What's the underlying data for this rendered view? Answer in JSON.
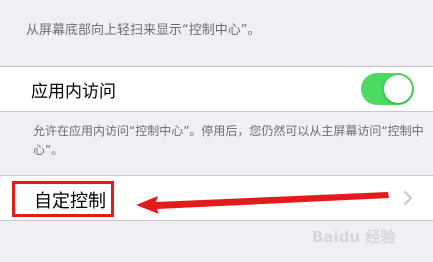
{
  "top_group": {
    "footer": "从屏幕底部向上轻扫来显示“控制中心”。"
  },
  "in_app_access": {
    "label": "应用内访问",
    "toggle_on": true,
    "toggle_color": "#4cd964",
    "footer": "允许在应用内访问“控制中心”。停用后，您仍然可以从主屏幕访问“控制中心”。"
  },
  "customize": {
    "label": "自定控制",
    "chevron_icon": "chevron-right-icon"
  },
  "annotation": {
    "color": "#e21b1b",
    "shape": "rectangle-highlight",
    "arrow_icon": "arrow-left-icon"
  },
  "watermark": "Baidu 经验"
}
